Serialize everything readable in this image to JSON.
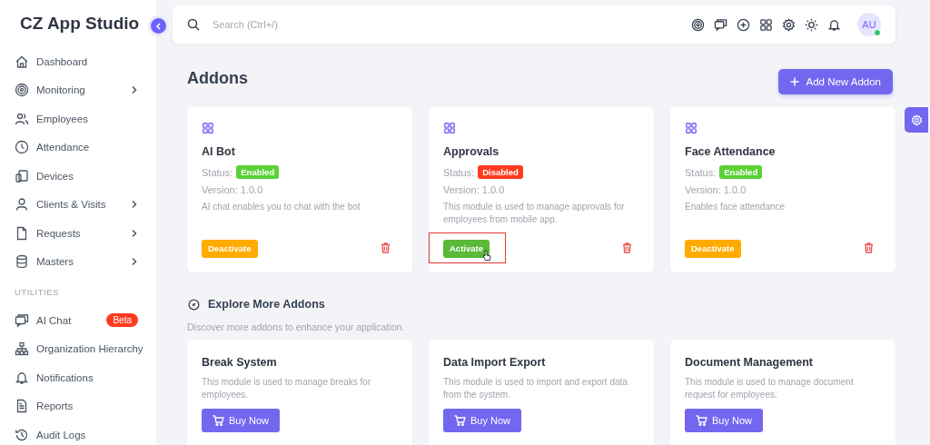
{
  "brand": "CZ App Studio",
  "sidebar": {
    "items": [
      {
        "label": "Dashboard",
        "has_submenu": false
      },
      {
        "label": "Monitoring",
        "has_submenu": true
      },
      {
        "label": "Employees",
        "has_submenu": false
      },
      {
        "label": "Attendance",
        "has_submenu": false
      },
      {
        "label": "Devices",
        "has_submenu": false
      },
      {
        "label": "Clients & Visits",
        "has_submenu": true
      },
      {
        "label": "Requests",
        "has_submenu": true
      },
      {
        "label": "Masters",
        "has_submenu": true
      }
    ],
    "section": "UTILITIES",
    "utilities": [
      {
        "label": "AI Chat",
        "badge": "Beta"
      },
      {
        "label": "Organization Hierarchy"
      },
      {
        "label": "Notifications"
      },
      {
        "label": "Reports"
      },
      {
        "label": "Audit Logs"
      }
    ]
  },
  "search": {
    "placeholder": "Search (Ctrl+/)"
  },
  "avatar": {
    "initials": "AU",
    "online": true
  },
  "page_title": "Addons",
  "add_button": "Add New Addon",
  "addons": [
    {
      "name": "AI Bot",
      "status_label": "Status:",
      "status": "Enabled",
      "enabled": true,
      "version": "Version: 1.0.0",
      "description": "AI chat enables you to chat with the bot",
      "action": "Deactivate",
      "highlighted": false
    },
    {
      "name": "Approvals",
      "status_label": "Status:",
      "status": "Disabled",
      "enabled": false,
      "version": "Version: 1.0.0",
      "description": "This module is used to manage approvals for employees from mobile app.",
      "action": "Activate",
      "highlighted": true
    },
    {
      "name": "Face Attendance",
      "status_label": "Status:",
      "status": "Enabled",
      "enabled": true,
      "version": "Version: 1.0.0",
      "description": "Enables face attendance",
      "action": "Deactivate",
      "highlighted": false
    }
  ],
  "explore": {
    "title": "Explore More Addons",
    "subtitle": "Discover more addons to enhance your application.",
    "items": [
      {
        "name": "Break System",
        "description": "This module is used to manage breaks for employees.",
        "button": "Buy Now"
      },
      {
        "name": "Data Import Export",
        "description": "This module is used to import and export data from the system.",
        "button": "Buy Now"
      },
      {
        "name": "Document Management",
        "description": "This module is used to manage document request for employees.",
        "button": "Buy Now"
      }
    ]
  }
}
